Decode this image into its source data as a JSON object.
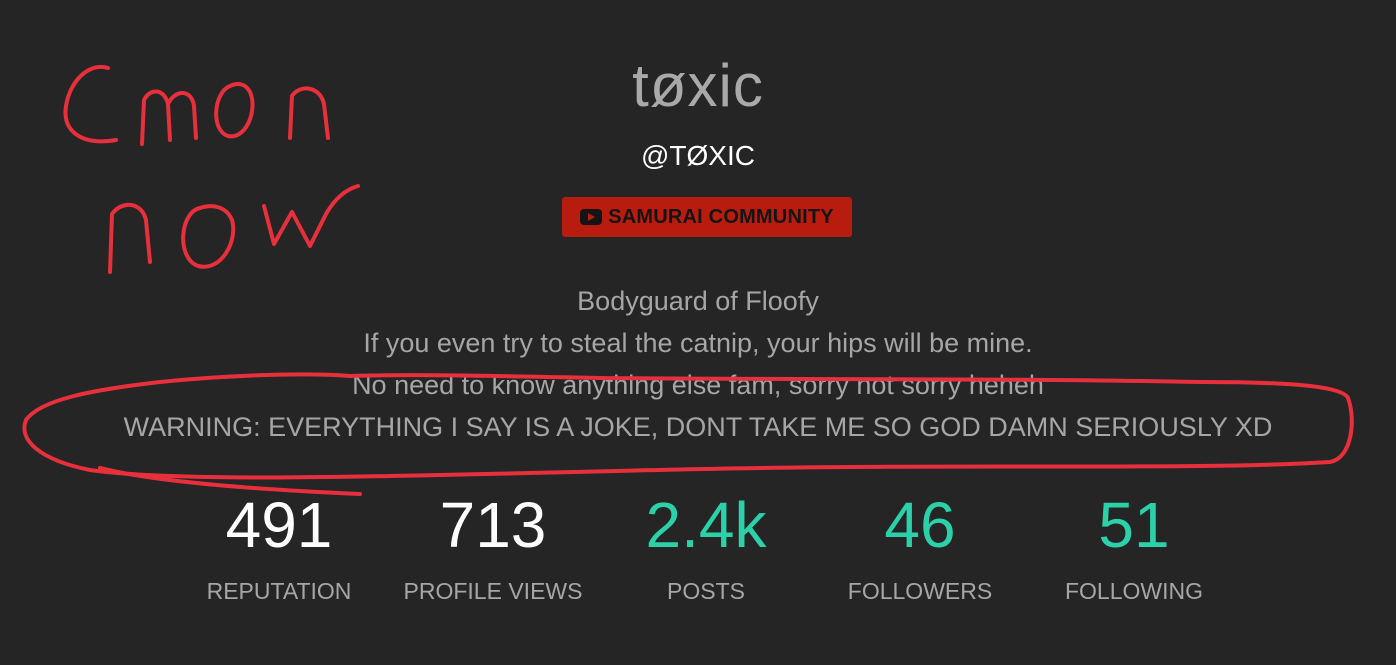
{
  "profile": {
    "display_name": "tøxic",
    "handle": "@TØXIC",
    "group_badge": {
      "label": "SAMURAI COMMUNITY",
      "icon": "youtube-play-icon",
      "color": "#b81c0e"
    },
    "bio_lines": [
      "Bodyguard of Floofy",
      "If you even try to steal the catnip, your hips will be mine.",
      "No need to know anything else fam, sorry not sorry heheh",
      "WARNING: EVERYTHING I SAY IS A JOKE, DONT TAKE ME SO GOD DAMN SERIOUSLY XD"
    ]
  },
  "stats": [
    {
      "value": "491",
      "label": "REPUTATION"
    },
    {
      "value": "713",
      "label": "PROFILE VIEWS"
    },
    {
      "value": "2.4k",
      "label": "POSTS"
    },
    {
      "value": "46",
      "label": "FOLLOWERS"
    },
    {
      "value": "51",
      "label": "FOLLOWING"
    }
  ],
  "annotation": {
    "handwritten_text": "Cmon now",
    "ink_color": "#e8303c"
  },
  "colors": {
    "background": "#252525",
    "accent": "#2bd1a8",
    "muted_text": "#a6a6a6"
  }
}
